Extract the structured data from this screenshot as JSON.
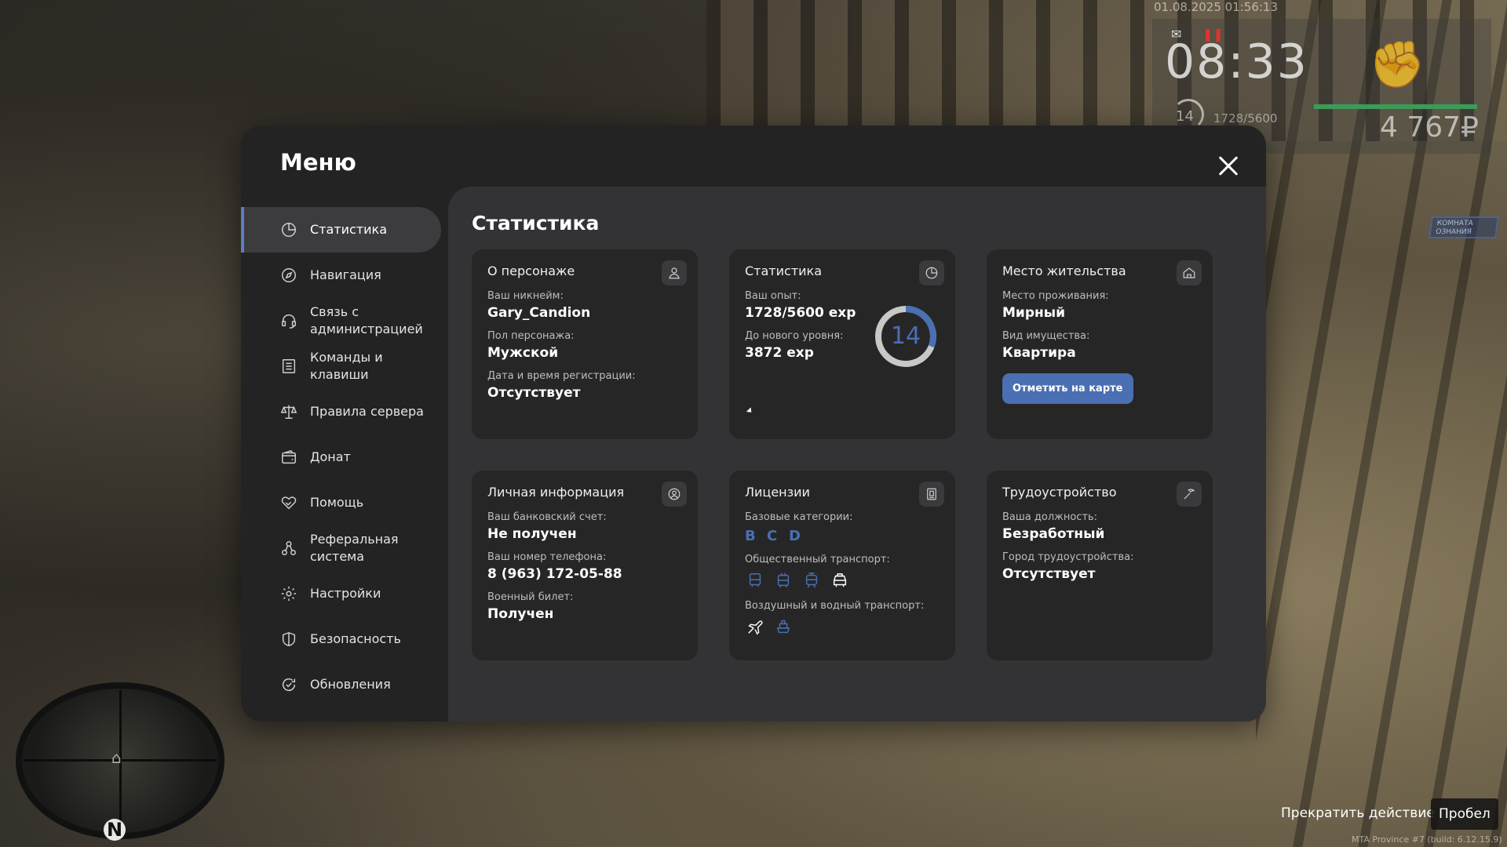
{
  "hud": {
    "datetime": "01.08.2025 01:56:13",
    "time": "08:33",
    "level": "14",
    "exp": "1728/5600",
    "money": "4 767₽"
  },
  "menu": {
    "title": "Меню",
    "sidebar": [
      {
        "label": "Статистика",
        "icon": "pie-chart-icon"
      },
      {
        "label": "Навигация",
        "icon": "compass-icon"
      },
      {
        "label": "Связь с администрацией",
        "icon": "headset-icon"
      },
      {
        "label": "Команды и клавиши",
        "icon": "list-icon"
      },
      {
        "label": "Правила сервера",
        "icon": "scales-icon"
      },
      {
        "label": "Донат",
        "icon": "wallet-icon"
      },
      {
        "label": "Помощь",
        "icon": "handshake-heart-icon"
      },
      {
        "label": "Реферальная система",
        "icon": "network-icon"
      },
      {
        "label": "Настройки",
        "icon": "gear-icon"
      },
      {
        "label": "Безопасность",
        "icon": "shield-icon"
      },
      {
        "label": "Обновления",
        "icon": "refresh-check-icon"
      }
    ],
    "section_title": "Статистика",
    "cards": {
      "character": {
        "title": "О персонаже",
        "nick_label": "Ваш никнейм:",
        "nick": "Gary_Candion",
        "gender_label": "Пол персонажа:",
        "gender": "Мужской",
        "reg_label": "Дата и время регистрации:",
        "reg": "Отсутствует"
      },
      "stats": {
        "title": "Статистика",
        "exp_label": "Ваш опыт:",
        "exp": "1728/5600 exp",
        "next_label": "До нового уровня:",
        "next": "3872 exp",
        "level": "14",
        "progress": 0.3086
      },
      "residence": {
        "title": "Место жительства",
        "place_label": "Место проживания:",
        "place": "Мирный",
        "type_label": "Вид имущества:",
        "type": "Квартира",
        "map_button": "Отметить на карте"
      },
      "personal": {
        "title": "Личная информация",
        "bank_label": "Ваш банковский счет:",
        "bank": "Не получен",
        "phone_label": "Ваш номер телефона:",
        "phone": "8 (963) 172-05-88",
        "military_label": "Военный билет:",
        "military": "Получен"
      },
      "licenses": {
        "title": "Лицензии",
        "basic_label": "Базовые категории:",
        "basic": [
          "B",
          "C",
          "D"
        ],
        "public_label": "Общественный транспорт:",
        "air_label": "Воздушный и водный транспорт:"
      },
      "employment": {
        "title": "Трудоустройство",
        "position_label": "Ваша должность:",
        "position": "Безработный",
        "city_label": "Город трудоустройства:",
        "city": "Отсутствует"
      }
    }
  },
  "hints": {
    "action": "Прекратить действие",
    "key": "Пробел",
    "build": "MTA Province #7 (build: 6.12.15.9)"
  },
  "colors": {
    "accent": "#4a6fb3",
    "panel": "#232324",
    "content": "#333335",
    "card": "#262627"
  }
}
